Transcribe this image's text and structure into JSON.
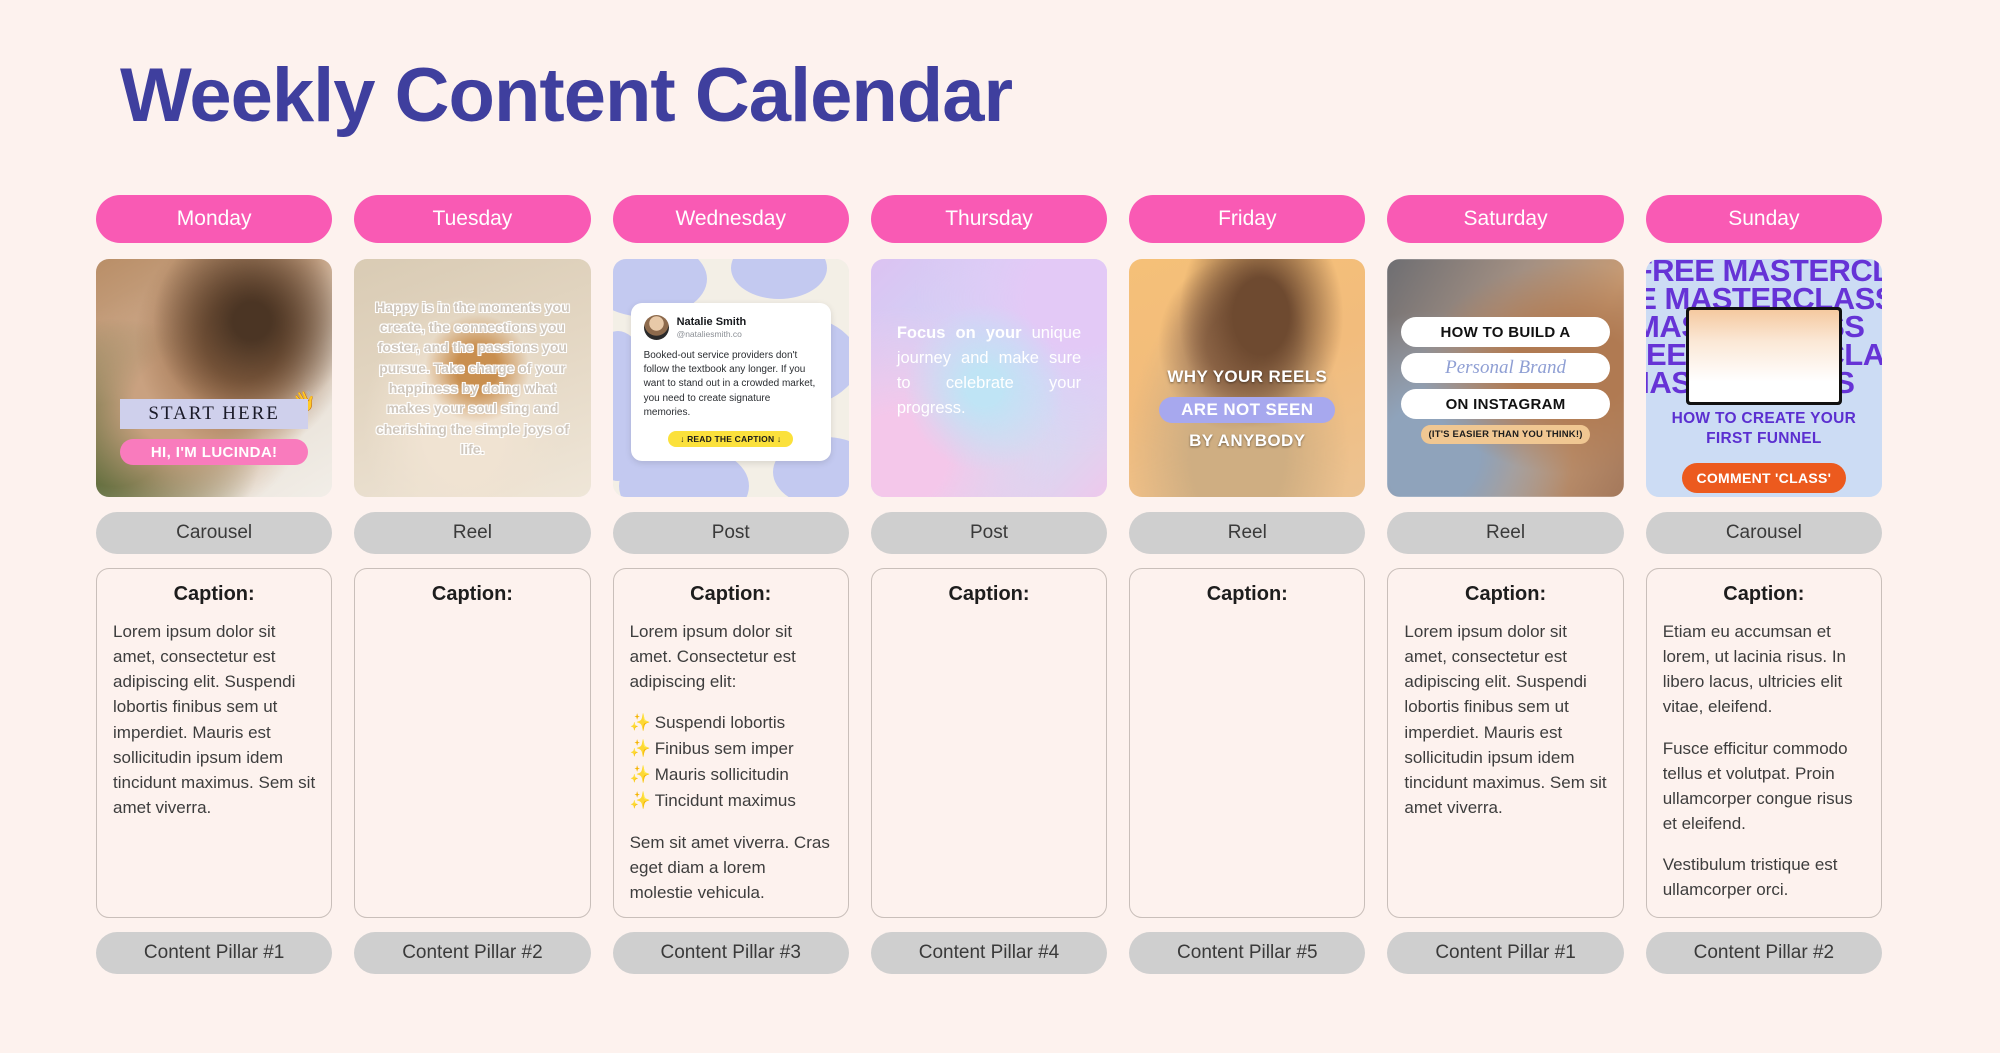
{
  "page": {
    "title": "Weekly Content Calendar",
    "background_color": "#fdf2ee",
    "title_color": "#3f3f9e",
    "day_pill_color": "#f95ab4",
    "type_pill_color": "#cfcfcf"
  },
  "columns": [
    {
      "day": "Monday",
      "type": "Carousel",
      "pillar": "Content Pillar #1",
      "caption_title": "Caption:",
      "caption_paragraphs": [
        "Lorem ipsum dolor sit amet, consectetur est adipiscing elit. Suspendi lobortis finibus sem ut imperdiet. Mauris est sollicitudin ipsum idem tincidunt maximus. Sem sit amet viverra."
      ],
      "media": {
        "kind": "photo-overlay",
        "band_text": "START HERE",
        "pill_text": "HI, I'M LUCINDA!",
        "emoji": "👋"
      }
    },
    {
      "day": "Tuesday",
      "type": "Reel",
      "pillar": "Content Pillar #2",
      "caption_title": "Caption:",
      "caption_paragraphs": [],
      "media": {
        "kind": "quote-photo",
        "quote": "Happy is in the moments you create, the connections you foster, and the passions you pursue. Take charge of your happiness by doing what makes your soul sing and cherishing the simple joys of life."
      }
    },
    {
      "day": "Wednesday",
      "type": "Post",
      "pillar": "Content Pillar #3",
      "caption_title": "Caption:",
      "caption_intro": "Lorem ipsum dolor sit amet. Consectetur est adipiscing elit:",
      "caption_bullets": [
        "Suspendi lobortis",
        "Finibus sem  imper",
        "Mauris sollicitudin",
        "Tincidunt maximus"
      ],
      "caption_outro": "Sem sit amet viverra. Cras eget diam a lorem molestie vehicula.",
      "bullet_icon": "✨",
      "media": {
        "kind": "tweet-card",
        "author_name": "Natalie Smith",
        "author_handle": "@nataliesmith.co",
        "tweet_text": "Booked-out service providers don't follow the textbook any longer. If you want to stand out in a crowded market, you need to create signature memories.",
        "cta": "↓ READ THE CAPTION ↓"
      }
    },
    {
      "day": "Thursday",
      "type": "Post",
      "pillar": "Content Pillar #4",
      "caption_title": "Caption:",
      "caption_paragraphs": [],
      "media": {
        "kind": "gradient-quote",
        "bold_lead": "Focus on your",
        "rest": " unique journey and make sure to celebrate your progress."
      }
    },
    {
      "day": "Friday",
      "type": "Reel",
      "pillar": "Content Pillar #5",
      "caption_title": "Caption:",
      "caption_paragraphs": [],
      "media": {
        "kind": "photo-3line",
        "line1": "WHY YOUR REELS",
        "line2": "ARE NOT SEEN",
        "line3": "BY ANYBODY"
      }
    },
    {
      "day": "Saturday",
      "type": "Reel",
      "pillar": "Content Pillar #1",
      "caption_title": "Caption:",
      "caption_paragraphs": [
        "Lorem ipsum dolor sit amet, consectetur est adipiscing elit. Suspendi lobortis finibus sem ut imperdiet. Mauris est sollicitudin ipsum idem tincidunt maximus. Sem sit amet viverra."
      ],
      "media": {
        "kind": "stacked-pills",
        "pill1": "HOW TO BUILD A",
        "pill2": "Personal Brand",
        "pill3": "ON INSTAGRAM",
        "note": "(IT'S EASIER THAN YOU THINK!)"
      }
    },
    {
      "day": "Sunday",
      "type": "Carousel",
      "pillar": "Content Pillar #2",
      "caption_title": "Caption:",
      "caption_paragraphs": [
        "Etiam eu accumsan et lorem, ut lacinia risus. In libero lacus, ultricies elit vitae, eleifend.",
        "Fusce efficitur commodo tellus et volutpat. Proin ullamcorper congue risus et eleifend.",
        "Vestibulum tristique est ullamcorper orci."
      ],
      "media": {
        "kind": "masterclass",
        "bg_word": "FREE MASTERCLASS",
        "headline": "HOW TO CREATE YOUR FIRST FUNNEL",
        "cta": "COMMENT 'CLASS'"
      }
    }
  ]
}
